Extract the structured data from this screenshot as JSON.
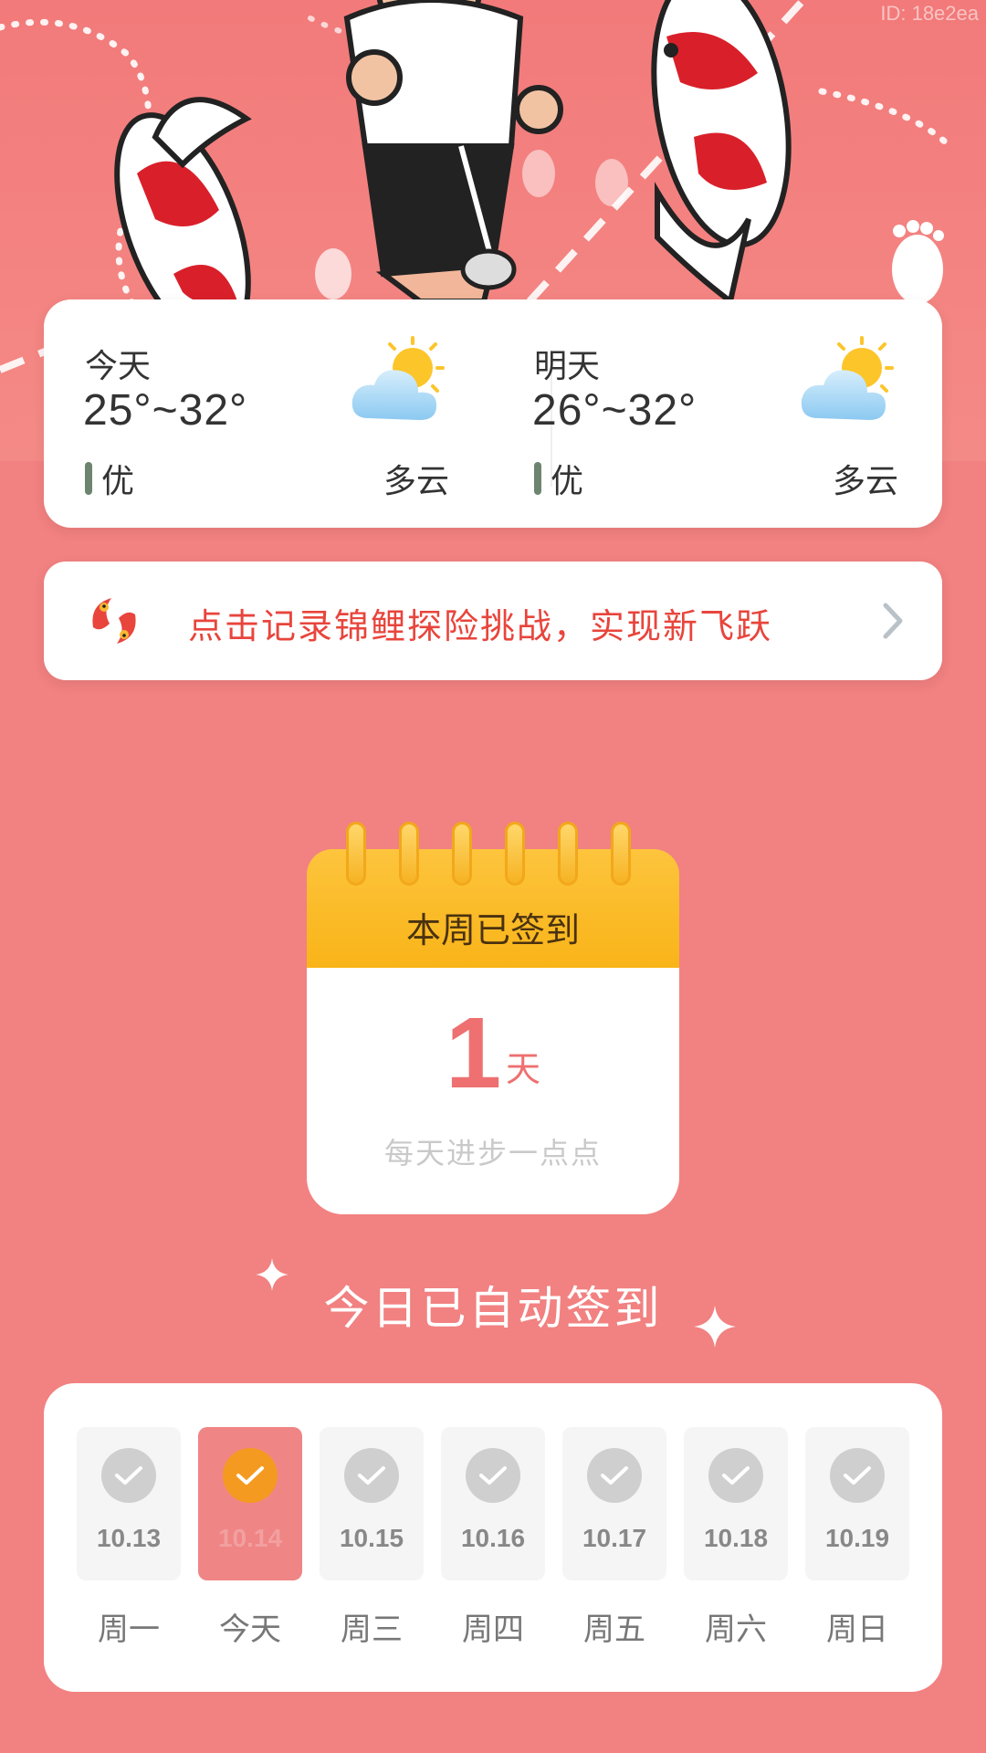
{
  "watermark": "ID: 18e2ea",
  "weather": {
    "today": {
      "day": "今天",
      "temp": "25°~32°",
      "quality": "优",
      "condition": "多云",
      "icon": "partly-cloudy-icon"
    },
    "tomorrow": {
      "day": "明天",
      "temp": "26°~32°",
      "quality": "优",
      "condition": "多云",
      "icon": "partly-cloudy-icon"
    }
  },
  "banner": {
    "text": "点击记录锦鲤探险挑战，实现新飞跃",
    "icon": "koi-icon",
    "arrow": "chevron-right-icon"
  },
  "calendar": {
    "title": "本周已签到",
    "count": "1",
    "unit": "天",
    "subtitle": "每天进步一点点"
  },
  "status": {
    "auto_signed": "今日已自动签到"
  },
  "week": [
    {
      "date": "10.13",
      "label": "周一",
      "today": false
    },
    {
      "date": "10.14",
      "label": "今天",
      "today": true
    },
    {
      "date": "10.15",
      "label": "周三",
      "today": false
    },
    {
      "date": "10.16",
      "label": "周四",
      "today": false
    },
    {
      "date": "10.17",
      "label": "周五",
      "today": false
    },
    {
      "date": "10.18",
      "label": "周六",
      "today": false
    },
    {
      "date": "10.19",
      "label": "周日",
      "today": false
    }
  ],
  "colors": {
    "background": "#f28181",
    "accent": "#e8453c",
    "calendar_head": "#fbbd2b",
    "today_check": "#f59a20"
  }
}
